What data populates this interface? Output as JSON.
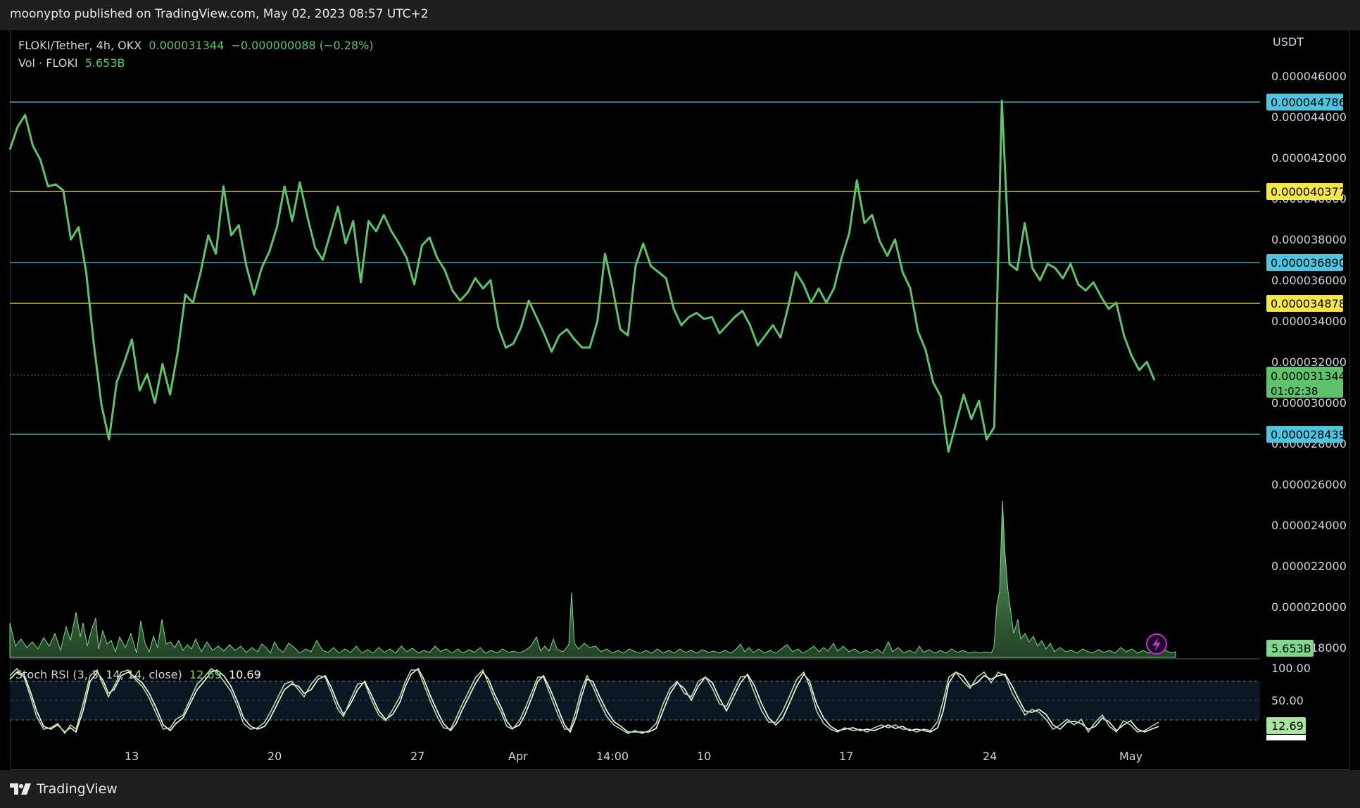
{
  "header": {
    "publisher_line": "moonypto published on TradingView.com, May 02, 2023 08:57 UTC+2"
  },
  "footer": {
    "brand": "TradingView"
  },
  "legend": {
    "symbol": "FLOKI/Tether, 4h, OKX",
    "price": "0.000031344",
    "change": "−0.000000088 (−0.28%)",
    "vol_label": "Vol · FLOKI",
    "vol_value": "5.653B"
  },
  "stoch_legend": {
    "label": "Stoch RSI (3, 3, 14, 14, close)",
    "k_value": "12.69",
    "d_value": "10.69"
  },
  "price_axis": {
    "currency": "USDT",
    "ticks": [
      "0.000046000",
      "0.000044000",
      "0.000042000",
      "0.000040000",
      "0.000038000",
      "0.000036000",
      "0.000034000",
      "0.000032000",
      "0.000030000",
      "0.000028000",
      "0.000026000",
      "0.000024000",
      "0.000022000",
      "0.000020000",
      "0.000018000"
    ]
  },
  "time_axis": {
    "ticks": [
      "13",
      "20",
      "27",
      "Apr",
      "14:00",
      "10",
      "17",
      "24",
      "May"
    ]
  },
  "stoch_axis": {
    "ticks": [
      "100.00",
      "50.00"
    ],
    "k_badge": "12.69",
    "d_badge": "10.69"
  },
  "price_badges": {
    "current_price": "0.000031344",
    "countdown": "01:02:38",
    "volume": "5.653B"
  },
  "colors": {
    "price_line": "#5fc36b",
    "cyan_level": "#4dc4e0",
    "yellow_level": "#f5e64a",
    "volume": "#7fd88a",
    "stoch_k": "#c5f2c0",
    "stoch_d": "#ffffff"
  },
  "chart_data": {
    "type": "line",
    "title": "FLOKI/Tether, 4h, OKX",
    "ylabel": "USDT",
    "ylim": [
      1.75e-05,
      4.74e-05
    ],
    "x_ticks": [
      "13",
      "20",
      "27",
      "Apr",
      "14:00",
      "10",
      "17",
      "24",
      "May"
    ],
    "levels": [
      {
        "label": "0.000044786",
        "value": 4.4786e-05,
        "color": "#4dc4e0"
      },
      {
        "label": "0.000040377",
        "value": 4.0377e-05,
        "color": "#f5e64a"
      },
      {
        "label": "0.000036890",
        "value": 3.689e-05,
        "color": "#4dc4e0"
      },
      {
        "label": "0.000034878",
        "value": 3.4878e-05,
        "color": "#f5e64a"
      },
      {
        "label": "0.000028439",
        "value": 2.8439e-05,
        "color": "#4dc4e0"
      }
    ],
    "series": [
      {
        "name": "FLOKI/Tether",
        "values": [
          4.26e-05,
          4.37e-05,
          4.43e-05,
          4.28e-05,
          4.21e-05,
          4.08e-05,
          4.09e-05,
          4.06e-05,
          3.82e-05,
          3.88e-05,
          3.66e-05,
          3.31e-05,
          3.01e-05,
          2.84e-05,
          3.12e-05,
          3.22e-05,
          3.33e-05,
          3.08e-05,
          3.16e-05,
          3.02e-05,
          3.21e-05,
          3.06e-05,
          3.27e-05,
          3.55e-05,
          3.51e-05,
          3.66e-05,
          3.84e-05,
          3.75e-05,
          4.08e-05,
          3.84e-05,
          3.89e-05,
          3.69e-05,
          3.55e-05,
          3.68e-05,
          3.76e-05,
          3.88e-05,
          4.08e-05,
          3.91e-05,
          4.1e-05,
          3.93e-05,
          3.78e-05,
          3.72e-05,
          3.85e-05,
          3.98e-05,
          3.8e-05,
          3.91e-05,
          3.61e-05,
          3.91e-05,
          3.86e-05,
          3.94e-05,
          3.86e-05,
          3.8e-05,
          3.73e-05,
          3.6e-05,
          3.79e-05,
          3.83e-05,
          3.73e-05,
          3.67e-05,
          3.57e-05,
          3.52e-05,
          3.56e-05,
          3.63e-05,
          3.58e-05,
          3.62e-05,
          3.39e-05,
          3.29e-05,
          3.31e-05,
          3.39e-05,
          3.52e-05,
          3.44e-05,
          3.36e-05,
          3.27e-05,
          3.35e-05,
          3.38e-05,
          3.33e-05,
          3.29e-05,
          3.29e-05,
          3.42e-05,
          3.75e-05,
          3.58e-05,
          3.38e-05,
          3.35e-05,
          3.69e-05,
          3.8e-05,
          3.69e-05,
          3.66e-05,
          3.63e-05,
          3.48e-05,
          3.4e-05,
          3.44e-05,
          3.46e-05,
          3.43e-05,
          3.44e-05,
          3.36e-05,
          3.4e-05,
          3.44e-05,
          3.47e-05,
          3.4e-05,
          3.3e-05,
          3.35e-05,
          3.4e-05,
          3.34e-05,
          3.49e-05,
          3.66e-05,
          3.6e-05,
          3.51e-05,
          3.58e-05,
          3.51e-05,
          3.58e-05,
          3.73e-05,
          3.85e-05,
          4.11e-05,
          3.9e-05,
          3.94e-05,
          3.81e-05,
          3.74e-05,
          3.82e-05,
          3.66e-05,
          3.58e-05,
          3.37e-05,
          3.28e-05,
          3.12e-05,
          3.05e-05,
          2.78e-05,
          2.92e-05,
          3.06e-05,
          2.94e-05,
          3.03e-05,
          2.84e-05,
          2.9e-05,
          4.5e-05,
          3.7e-05,
          3.67e-05,
          3.9e-05,
          3.68e-05,
          3.62e-05,
          3.7e-05,
          3.68e-05,
          3.63e-05,
          3.7e-05,
          3.6e-05,
          3.57e-05,
          3.61e-05,
          3.54e-05,
          3.48e-05,
          3.51e-05,
          3.35e-05,
          3.25e-05,
          3.18e-05,
          3.22e-05,
          3.13e-05
        ]
      }
    ]
  }
}
